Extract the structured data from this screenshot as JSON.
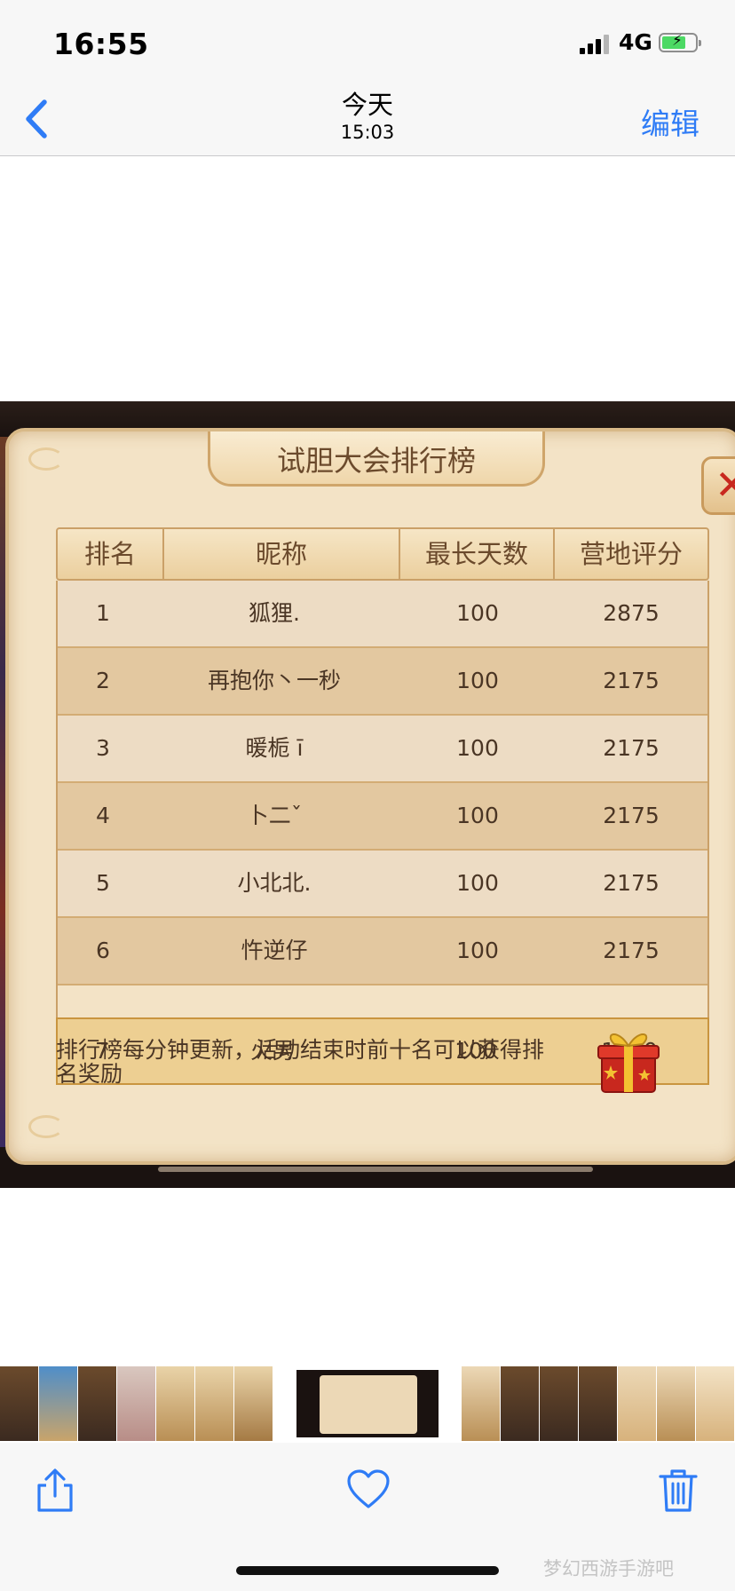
{
  "status": {
    "time": "16:55",
    "network": "4G"
  },
  "nav": {
    "title": "今天",
    "subtitle": "15:03",
    "edit_label": "编辑"
  },
  "leaderboard": {
    "title": "试胆大会排行榜",
    "columns": [
      "排名",
      "昵称",
      "最长天数",
      "营地评分"
    ],
    "rows": [
      {
        "rank": "1",
        "name": "狐狸.",
        "days": "100",
        "score": "2875"
      },
      {
        "rank": "2",
        "name": "再抱你丶一秒",
        "days": "100",
        "score": "2175"
      },
      {
        "rank": "3",
        "name": "暖栀 ī",
        "days": "100",
        "score": "2175"
      },
      {
        "rank": "4",
        "name": "卜二ˇ",
        "days": "100",
        "score": "2175"
      },
      {
        "rank": "5",
        "name": "小北北.",
        "days": "100",
        "score": "2175"
      },
      {
        "rank": "6",
        "name": "忤逆仔",
        "days": "100",
        "score": "2175"
      }
    ],
    "my_row": {
      "rank": "7",
      "name": "火男",
      "days": "100",
      "score": "1980"
    },
    "notice": "排行榜每分钟更新，活动结束时前十名可以获得排名奖励"
  },
  "watermark": "梦幻西游手游吧",
  "colors": {
    "ios_blue": "#2f7cf6",
    "panel_bg": "#f3e3c6",
    "row_light": "#eddcc4",
    "row_dark": "#e3c8a0",
    "highlight_row": "#edcf92",
    "title_text": "#6b4a2c",
    "close_red": "#c8281e"
  },
  "icons": [
    "back-chevron-icon",
    "close-icon",
    "gift-box-icon",
    "share-icon",
    "heart-icon",
    "trash-icon"
  ]
}
